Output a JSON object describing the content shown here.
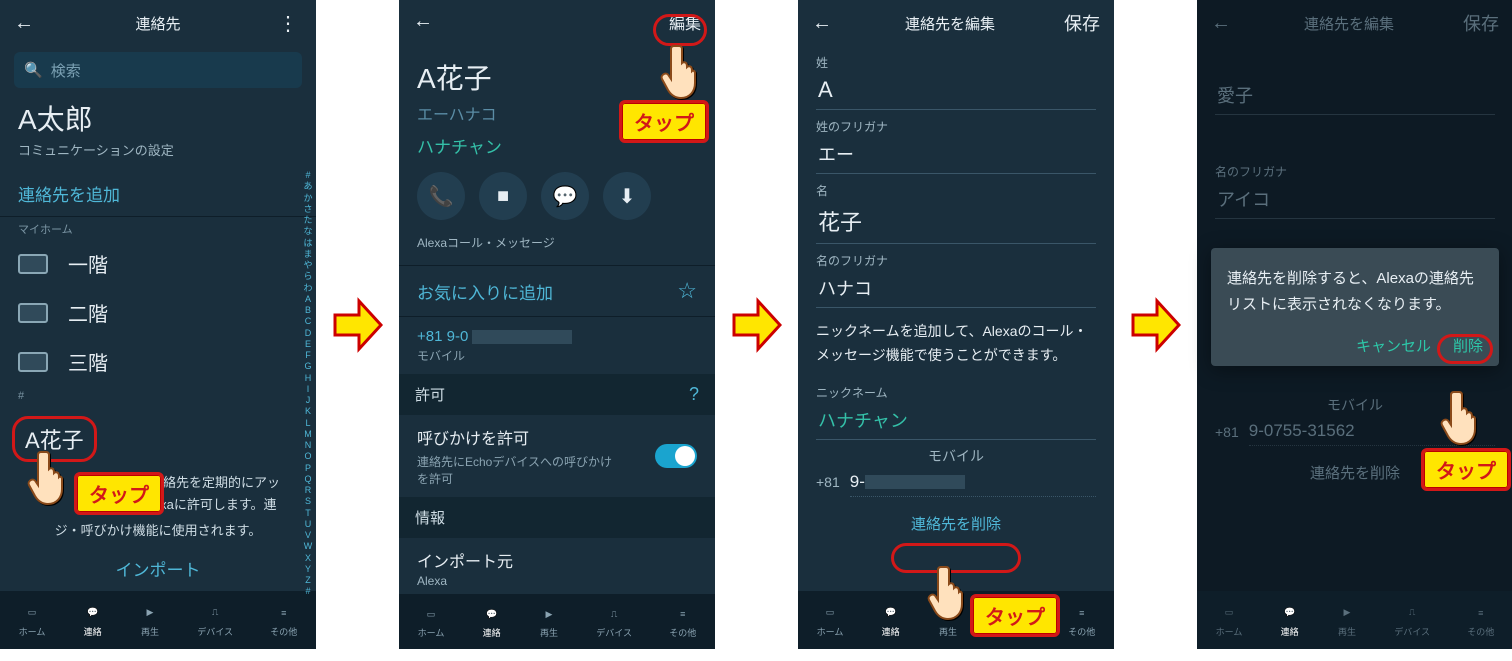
{
  "nav": {
    "home": "ホーム",
    "contacts": "連絡",
    "play": "再生",
    "devices": "デバイス",
    "other": "その他"
  },
  "arrow": "→",
  "tap_label": "タップ",
  "screen1": {
    "title": "連絡先",
    "search_placeholder": "検索",
    "profile_name": "A太郎",
    "comm_settings": "コミュニケーションの設定",
    "add_contact": "連絡先を追加",
    "my_home": "マイホーム",
    "rooms": [
      "一階",
      "二階",
      "三階"
    ],
    "hash": "#",
    "contact_a": "A花子",
    "info_text1": "連絡先を定期的にアッlexaに許可します。連",
    "info_text2": "ジ・呼びかけ機能に使用されます。",
    "import": "インポート",
    "index": "#あかさたなはまやらわABCDEFGHIJKLMNOPQRSTUVWXYZ#"
  },
  "screen2": {
    "edit": "編集",
    "name_big": "A花子",
    "name_kana": "エーハナコ",
    "nickname": "ハナチャン",
    "alexa_note": "Alexaコール・メッセージ",
    "fav": "お気に入りに追加",
    "phone_prefix": "+81 9-0",
    "mobile": "モバイル",
    "permission": "許可",
    "dropin": "呼びかけを許可",
    "dropin_sub": "連絡先にEchoデバイスへの呼びかけを許可",
    "info": "情報",
    "import_from": "インポート元",
    "alexa": "Alexa"
  },
  "screen3": {
    "title": "連絡先を編集",
    "save": "保存",
    "lastname_lbl": "姓",
    "lastname": "A",
    "lastname_kana_lbl": "姓のフリガナ",
    "lastname_kana": "エー",
    "firstname_lbl": "名",
    "firstname": "花子",
    "firstname_kana_lbl": "名のフリガナ",
    "firstname_kana": "ハナコ",
    "nick_para": "ニックネームを追加して、Alexaのコール・メッセージ機能で使うことができます。",
    "nickname_lbl": "ニックネーム",
    "nickname": "ハナチャン",
    "mobile_lbl": "モバイル",
    "prefix": "+81",
    "num": "9-",
    "delete": "連絡先を削除"
  },
  "screen4": {
    "title": "連絡先を編集",
    "save": "保存",
    "aiko": "愛子",
    "firstname_kana_lbl": "名のフリガナ",
    "aiko_kana": "アイコ",
    "dialog_msg": "連絡先を削除すると、Alexaの連絡先リストに表示されなくなります。",
    "cancel": "キャンセル",
    "delete": "削除",
    "mobile_lbl": "モバイル",
    "prefix": "+81",
    "num": "9-0755-31562",
    "delete_link": "連絡先を削除"
  }
}
